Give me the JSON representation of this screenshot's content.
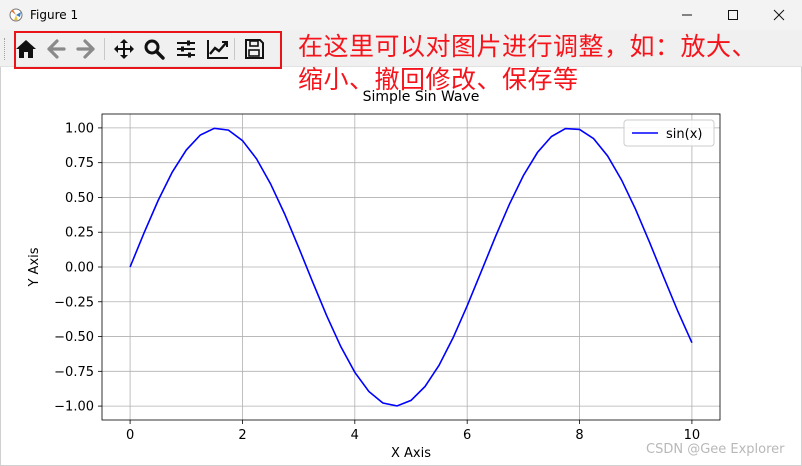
{
  "window": {
    "title": "Figure 1"
  },
  "toolbar": {
    "buttons": [
      {
        "icon": "home-icon",
        "label": "Home"
      },
      {
        "icon": "back-arrow-icon",
        "label": "Back"
      },
      {
        "icon": "forward-arrow-icon",
        "label": "Forward"
      },
      {
        "icon": "pan-icon",
        "label": "Pan"
      },
      {
        "icon": "zoom-icon",
        "label": "Zoom"
      },
      {
        "icon": "subplots-icon",
        "label": "Subplots"
      },
      {
        "icon": "edit-axis-icon",
        "label": "Customize"
      },
      {
        "icon": "save-icon",
        "label": "Save"
      }
    ]
  },
  "annotation": {
    "text": "在这里可以对图片进行调整，如：放大、缩小、撤回修改、保存等",
    "color": "#f5141c"
  },
  "chart_data": {
    "type": "line",
    "title": "Simple Sin Wave",
    "xlabel": "X Axis",
    "ylabel": "Y Axis",
    "xlim": [
      -0.5,
      10.5
    ],
    "ylim": [
      -1.1,
      1.1
    ],
    "xticks": [
      0,
      2,
      4,
      6,
      8,
      10
    ],
    "yticks": [
      1.0,
      0.75,
      0.5,
      0.25,
      0.0,
      -0.25,
      -0.5,
      -0.75,
      -1.0
    ],
    "xtick_labels": [
      "0",
      "2",
      "4",
      "6",
      "8",
      "10"
    ],
    "ytick_labels": [
      "1.00",
      "0.75",
      "0.50",
      "0.25",
      "0.00",
      "−0.25",
      "−0.50",
      "−0.75",
      "−1.00"
    ],
    "grid": true,
    "legend": "top-right",
    "series": [
      {
        "name": "sin(x)",
        "color": "#0000ff",
        "x": [
          0,
          0.25,
          0.5,
          0.75,
          1,
          1.25,
          1.5,
          1.75,
          2,
          2.25,
          2.5,
          2.75,
          3,
          3.25,
          3.5,
          3.75,
          4,
          4.25,
          4.5,
          4.75,
          5,
          5.25,
          5.5,
          5.75,
          6,
          6.25,
          6.5,
          6.75,
          7,
          7.25,
          7.5,
          7.75,
          8,
          8.25,
          8.5,
          8.75,
          9,
          9.25,
          9.5,
          9.75,
          10
        ],
        "y": [
          0,
          0.247,
          0.479,
          0.682,
          0.841,
          0.949,
          0.997,
          0.984,
          0.909,
          0.778,
          0.598,
          0.382,
          0.141,
          -0.108,
          -0.351,
          -0.572,
          -0.757,
          -0.895,
          -0.978,
          -0.999,
          -0.959,
          -0.859,
          -0.706,
          -0.508,
          -0.279,
          -0.033,
          0.215,
          0.45,
          0.657,
          0.823,
          0.938,
          0.995,
          0.989,
          0.923,
          0.798,
          0.624,
          0.412,
          0.174,
          -0.075,
          -0.319,
          -0.544
        ]
      }
    ]
  },
  "watermark": "CSDN @Gee Explorer"
}
